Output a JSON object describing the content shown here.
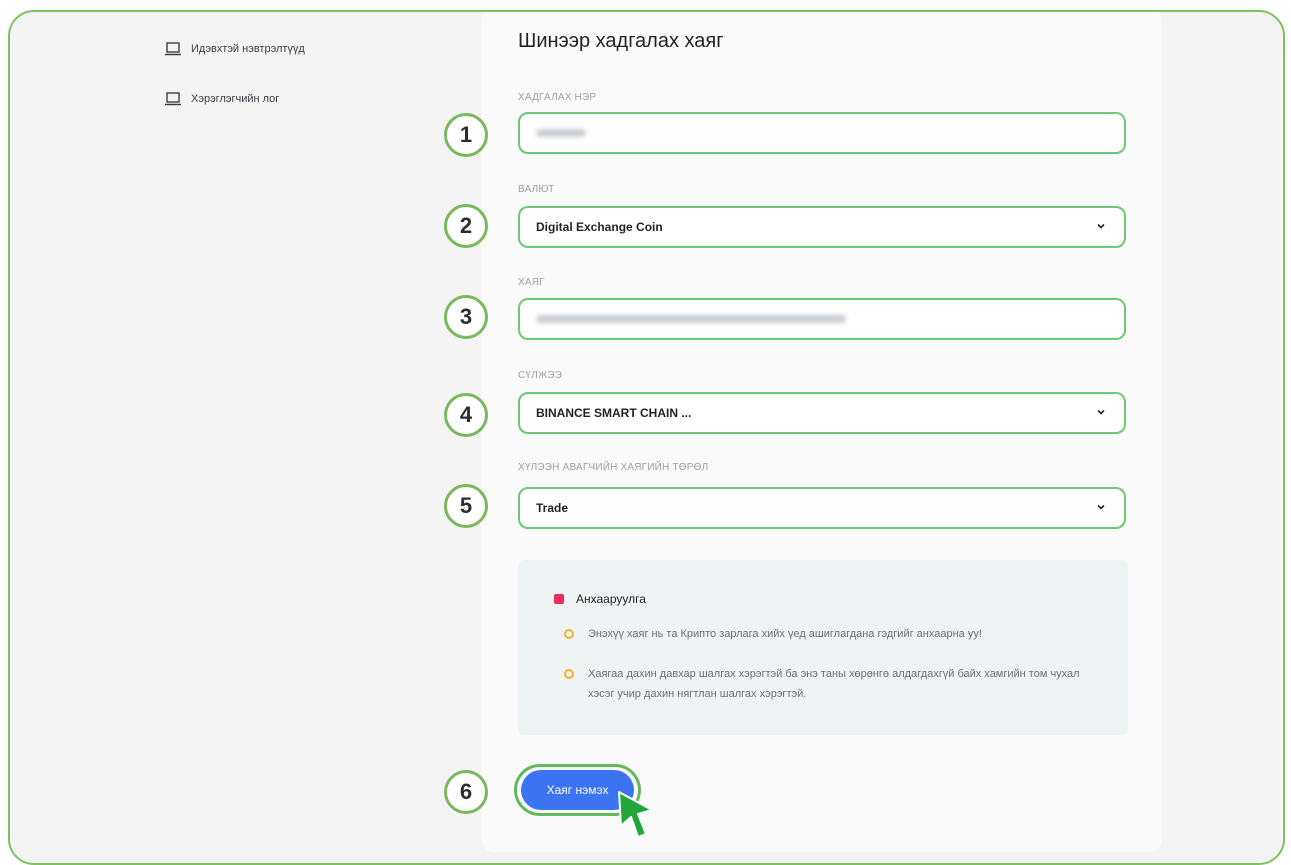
{
  "sidebar": {
    "items": [
      {
        "label": "Идэвхтэй нэвтрэлтүүд",
        "icon": "laptop-icon"
      },
      {
        "label": "Хэрэглэгчийн лог",
        "icon": "laptop-icon"
      }
    ]
  },
  "form": {
    "title": "Шинээр хадгалах хаяг",
    "name_label": "ХАДГАЛАХ НЭР",
    "currency_label": "ВАЛЮТ",
    "currency_value": "Digital Exchange Coin",
    "address_label": "ХАЯГ",
    "network_label": "СҮЛЖЭЭ",
    "network_value": "BINANCE SMART CHAIN ...",
    "type_label": "ХҮЛЭЭН АВАГЧИЙН ХАЯГИЙН ТӨРӨЛ",
    "type_value": "Trade",
    "submit_label": "Хаяг нэмэх"
  },
  "notice": {
    "title": "Анхааруулга",
    "items": [
      "Энэхүү хаяг нь та Крипто зарлага хийх үед ашиглагдана гэдгийг анхаарна уу!",
      "Хаягаа дахин давхар шалгах хэрэгтэй ба энэ таны хөрөнгө алдагдахгүй байх хамгийн том чухал хэсэг учир дахин нягтлан шалгах хэрэгтэй."
    ]
  },
  "steps": [
    "1",
    "2",
    "3",
    "4",
    "5",
    "6"
  ],
  "colors": {
    "accent": "#3b73f0",
    "highlight_border": "#6cc874",
    "warning_square": "#ec2c5a",
    "warning_ring": "#f2b431"
  }
}
